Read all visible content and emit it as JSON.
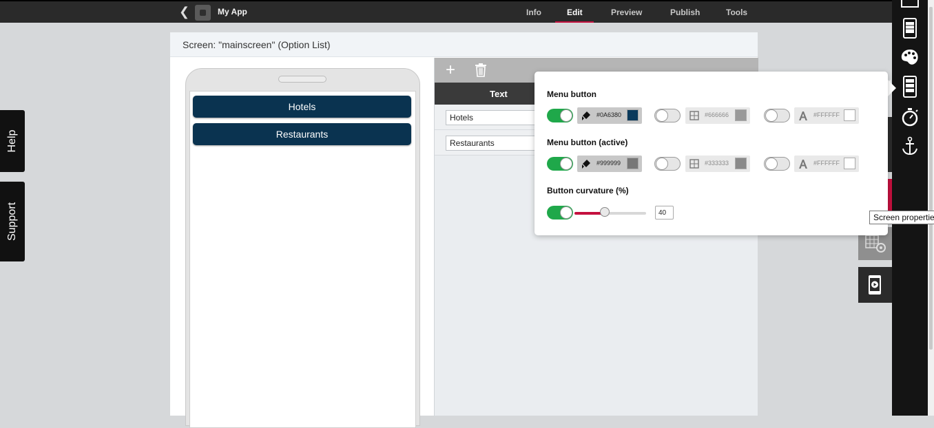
{
  "header": {
    "app_name": "My App",
    "tabs": [
      {
        "label": "Info"
      },
      {
        "label": "Edit"
      },
      {
        "label": "Preview"
      },
      {
        "label": "Publish"
      },
      {
        "label": "Tools"
      }
    ],
    "active_tab": "Edit"
  },
  "side_tabs": {
    "help": "Help",
    "support": "Support"
  },
  "screen": {
    "title": "Screen: \"mainscreen\" (Option List)"
  },
  "phone": {
    "buttons": [
      {
        "label": "Hotels"
      },
      {
        "label": "Restaurants"
      }
    ]
  },
  "editor": {
    "column_text": "Text",
    "rows": [
      {
        "value": "Hotels"
      },
      {
        "value": "Restaurants"
      }
    ]
  },
  "popup": {
    "menu_button": {
      "label": "Menu button",
      "background": {
        "enabled": true,
        "hex": "#0A6380",
        "chip": "#0A3A5C"
      },
      "border": {
        "enabled": false,
        "hex": "#666666",
        "chip": "#9a9a9a"
      },
      "text": {
        "enabled": false,
        "hex": "#FFFFFF",
        "chip": "#FFFFFF"
      }
    },
    "menu_button_active": {
      "label": "Menu button (active)",
      "background": {
        "enabled": true,
        "hex": "#999999",
        "chip": "#777777"
      },
      "border": {
        "enabled": false,
        "hex": "#333333",
        "chip": "#8a8a8a"
      },
      "text": {
        "enabled": false,
        "hex": "#FFFFFF",
        "chip": "#FFFFFF"
      }
    },
    "curvature": {
      "label": "Button curvature (%)",
      "enabled": true,
      "slider_fraction": 0.42,
      "value": "40"
    }
  },
  "tooltip": "Screen properties",
  "colors": {
    "accent": "#c4103e",
    "toggle_on": "#1fa84a",
    "menu_btn": "#0a3350"
  }
}
